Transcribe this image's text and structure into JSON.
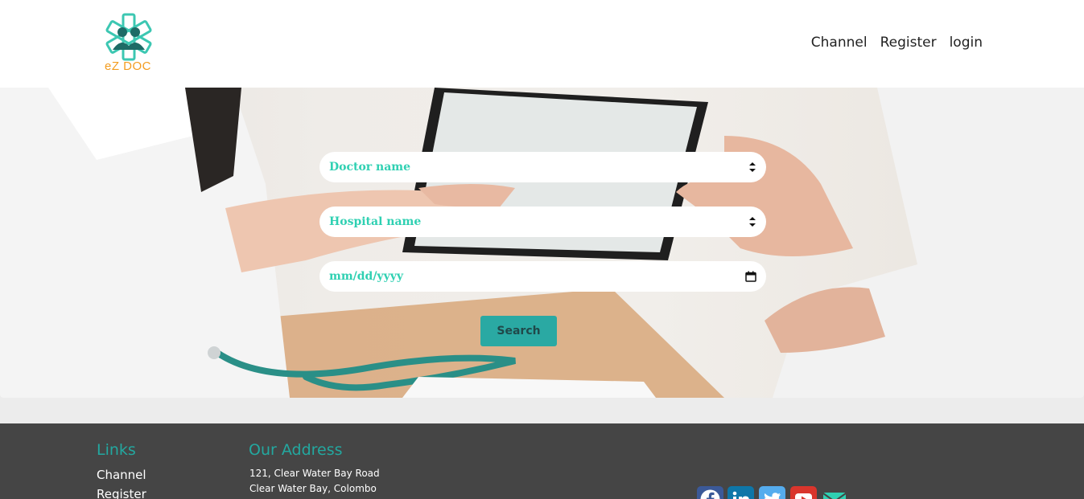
{
  "brand": {
    "logo_text": "eZ DOC"
  },
  "nav": {
    "channel": "Channel",
    "register": "Register",
    "login": "login"
  },
  "search_form": {
    "doctor_field": "Doctor name",
    "hospital_field": "Hospital name",
    "date_field": "mm/dd/yyyy",
    "search_button": "Search"
  },
  "footer": {
    "links_title": "Links",
    "links": [
      "Channel",
      "Register"
    ],
    "address_title": "Our Address",
    "address_lines": [
      "121, Clear Water Bay Road",
      "Clear Water Bay, Colombo"
    ],
    "social_icons": [
      "facebook-icon",
      "linkedin-icon",
      "twitter-icon",
      "youtube-icon",
      "email-icon"
    ]
  },
  "colors": {
    "accent": "#2aa9a3",
    "field_text": "#2fd0b2",
    "logo_orange": "#f39c1f",
    "footer_bg": "#454545"
  }
}
